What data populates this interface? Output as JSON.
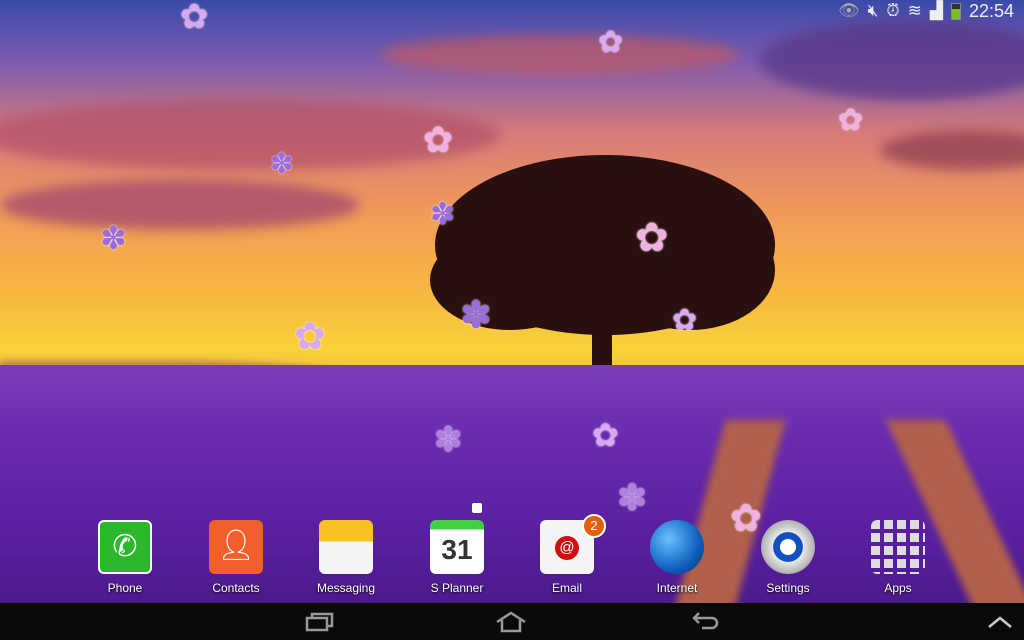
{
  "status_bar": {
    "time": "22:54",
    "icons": [
      "eye-icon",
      "mute-icon",
      "alarm-icon",
      "wifi-icon",
      "signal-icon",
      "battery-icon"
    ]
  },
  "dock": [
    {
      "label": "Phone",
      "icon": "phone-icon"
    },
    {
      "label": "Contacts",
      "icon": "contacts-icon"
    },
    {
      "label": "Messaging",
      "icon": "messaging-icon"
    },
    {
      "label": "S Planner",
      "icon": "calendar-icon",
      "day": "31"
    },
    {
      "label": "Email",
      "icon": "email-icon",
      "badge": "2"
    },
    {
      "label": "Internet",
      "icon": "globe-icon"
    },
    {
      "label": "Settings",
      "icon": "gear-icon"
    },
    {
      "label": "Apps",
      "icon": "apps-grid-icon"
    }
  ],
  "nav": [
    "recent-apps",
    "home",
    "back"
  ],
  "colors": {
    "sky_top": "#3a4aa8",
    "sunset": "#f8d23a",
    "lavender": "#6a2ab0",
    "nav_bg": "#0a0a0a"
  }
}
